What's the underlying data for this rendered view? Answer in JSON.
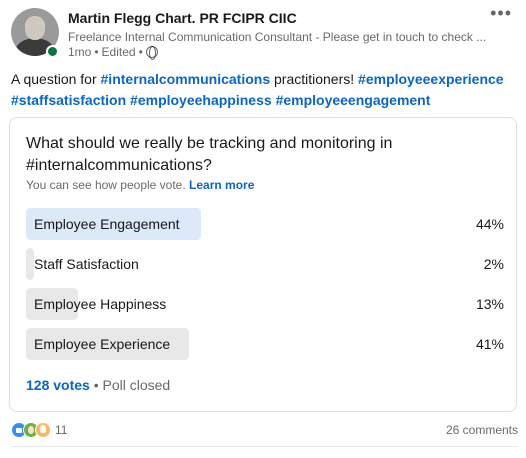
{
  "author": {
    "name": "Martin Flegg Chart. PR FCIPR CIIC",
    "headline": "Freelance Internal Communication Consultant - Please get in touch to check ...",
    "time": "1mo",
    "edited": "Edited",
    "separator": "•"
  },
  "post": {
    "text_before": "A question for ",
    "tag1": "#internalcommunications",
    "text_mid": " practitioners! ",
    "tag2": "#employeeexperience",
    "tag3": "#staffsatisfaction",
    "tag4": "#employeehappiness",
    "tag5": "#employeeengagement"
  },
  "poll": {
    "question": "What should we really be tracking and monitoring in #internalcommunications?",
    "visibility_text": "You can see how people vote.",
    "learn_more": "Learn more",
    "options": [
      {
        "label": "Employee Engagement",
        "percent": "44%",
        "fraction": 0.44,
        "winner": true
      },
      {
        "label": "Staff Satisfaction",
        "percent": "2%",
        "fraction": 0.02,
        "winner": false
      },
      {
        "label": "Employee Happiness",
        "percent": "13%",
        "fraction": 0.13,
        "winner": false
      },
      {
        "label": "Employee Experience",
        "percent": "41%",
        "fraction": 0.41,
        "winner": false
      }
    ],
    "votes": "128 votes",
    "status": "Poll closed"
  },
  "social": {
    "reaction_count": "11",
    "comments": "26 comments",
    "reaction_icons": [
      "like-icon",
      "celebrate-icon",
      "insight-icon"
    ]
  },
  "colors": {
    "link": "#0a66c2",
    "winner_bar": "#dce9f8",
    "bar": "#e8e8e8",
    "online": "#057642"
  }
}
